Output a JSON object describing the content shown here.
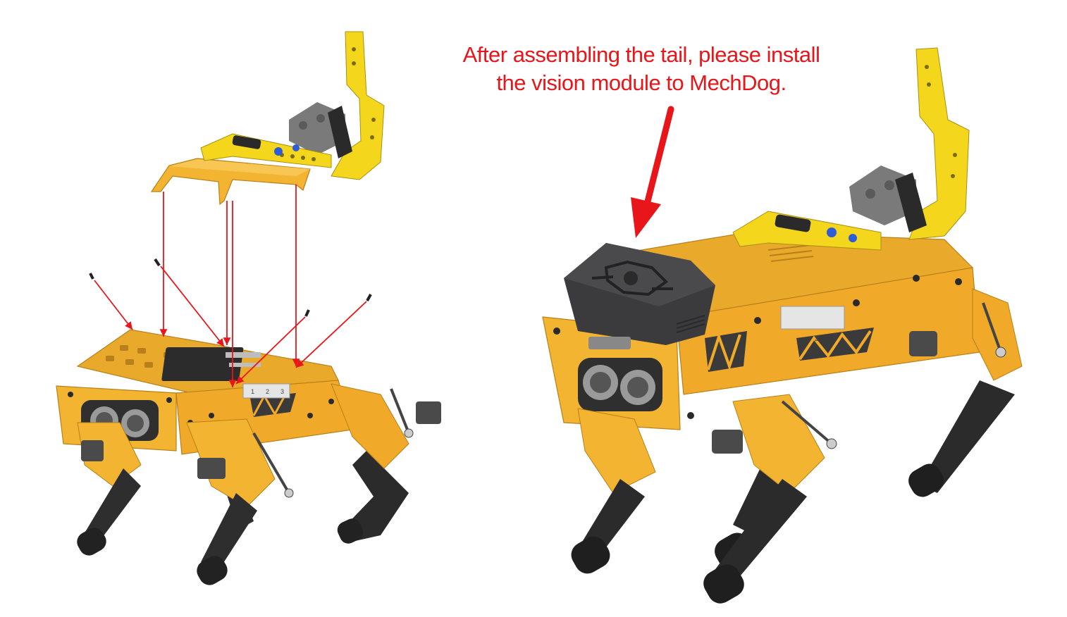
{
  "instruction": {
    "line1": "After assembling the tail, please install",
    "line2": "the vision module to MechDog."
  },
  "port_labels": [
    "1",
    "2",
    "3"
  ],
  "colors": {
    "annotation_red": "#e8161b",
    "body_yellow": "#f2b431",
    "tail_yellow": "#f4d71c",
    "dark_gray": "#333537",
    "leg_black": "#2b2b2b"
  }
}
